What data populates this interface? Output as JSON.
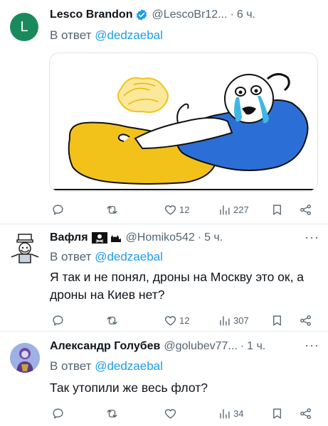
{
  "tweets": [
    {
      "name": "Lesco Brandon",
      "handle": "@LescoBr12...",
      "time": "6 ч.",
      "avatar_letter": "L",
      "avatar_color": "#1a8a5c",
      "reply_prefix": "В ответ",
      "reply_mention": "@dedzaebal",
      "text": "",
      "replies": "",
      "retweets": "",
      "likes": "12",
      "views": "227"
    },
    {
      "name": "Вафля",
      "handle": "@Homiko542",
      "time": "5 ч.",
      "reply_prefix": "В ответ",
      "reply_mention": "@dedzaebal",
      "text": "Я так и не понял, дроны на Москву это ок, а дроны на Киев нет?",
      "replies": "",
      "retweets": "",
      "likes": "12",
      "views": "307"
    },
    {
      "name": "Александр Голубев",
      "handle": "@golubev77...",
      "time": "1 ч.",
      "reply_prefix": "В ответ",
      "reply_mention": "@dedzaebal",
      "text": "Так утопили же весь флот?",
      "replies": "",
      "retweets": "",
      "likes": "",
      "views": "34"
    }
  ],
  "separator": "·",
  "more_glyph": "···",
  "colors": {
    "accent": "#1d9bf0",
    "secondary_text": "#536471",
    "verified": "#1d9bf0",
    "flag_blue": "#2b6fd6",
    "flag_yellow": "#f2c21b"
  }
}
